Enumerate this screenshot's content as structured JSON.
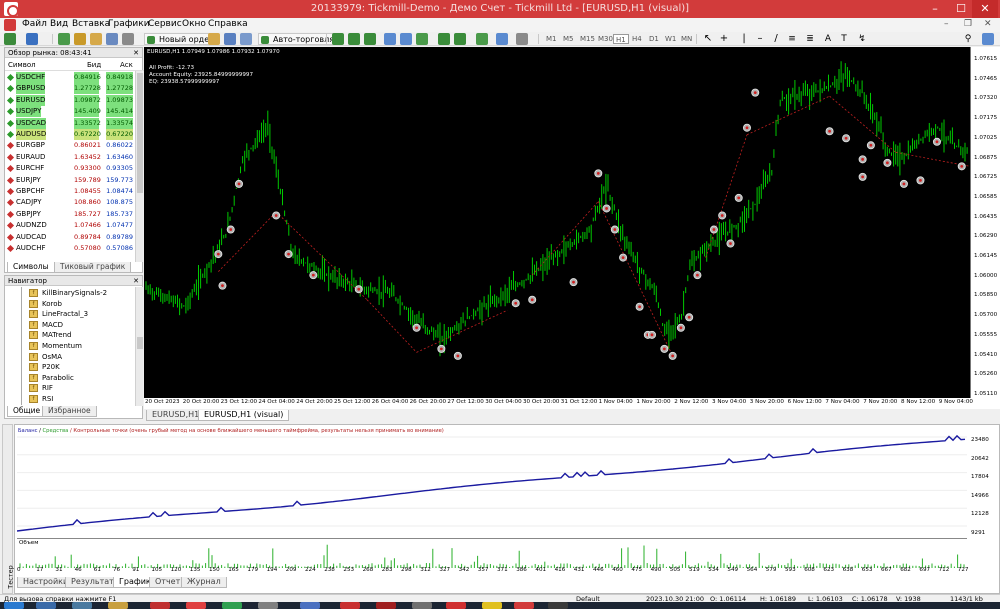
{
  "window": {
    "title": "20133979: Tickmill-Demo - Демо Счет - Tickmill Ltd - [EURUSD,H1 (visual)]"
  },
  "menu": [
    "Файл",
    "Вид",
    "Вставка",
    "Графики",
    "Сервис",
    "Окно",
    "Справка"
  ],
  "toolbar": {
    "new_order": "Новый ордер",
    "autotrade": "Авто-торговля",
    "timeframes": [
      "M1",
      "M5",
      "M15",
      "M30",
      "H1",
      "H4",
      "D1",
      "W1",
      "MN"
    ],
    "active_timeframe": "H1"
  },
  "market_watch": {
    "title": "Обзор рынка: 08:43:41",
    "col_symbol": "Символ",
    "col_bid": "Бид",
    "col_ask": "Аск",
    "rows": [
      {
        "symbol": "USDCHF",
        "bid": "0.84916",
        "ask": "0.84918",
        "bg": "#7de07d"
      },
      {
        "symbol": "GBPUSD",
        "bid": "1.27728",
        "ask": "1.27728",
        "bg": "#7de07d"
      },
      {
        "symbol": "EURUSD",
        "bid": "1.09872",
        "ask": "1.09873",
        "bg": "#7de07d"
      },
      {
        "symbol": "USDJPY",
        "bid": "145.409",
        "ask": "145.414",
        "bg": "#7de07d"
      },
      {
        "symbol": "USDCAD",
        "bid": "1.33572",
        "ask": "1.33574",
        "bg": "#7de07d"
      },
      {
        "symbol": "AUDUSD",
        "bid": "0.67220",
        "ask": "0.67220",
        "bg": "#c9e27a"
      },
      {
        "symbol": "EURGBP",
        "bid": "0.86021",
        "ask": "0.86022",
        "bg": "#ffffff"
      },
      {
        "symbol": "EURAUD",
        "bid": "1.63452",
        "ask": "1.63460",
        "bg": "#ffffff"
      },
      {
        "symbol": "EURCHF",
        "bid": "0.93300",
        "ask": "0.93305",
        "bg": "#ffffff"
      },
      {
        "symbol": "EURJPY",
        "bid": "159.789",
        "ask": "159.773",
        "bg": "#ffffff"
      },
      {
        "symbol": "GBPCHF",
        "bid": "1.08455",
        "ask": "1.08474",
        "bg": "#ffffff"
      },
      {
        "symbol": "CADJPY",
        "bid": "108.860",
        "ask": "108.875",
        "bg": "#ffffff"
      },
      {
        "symbol": "GBPJPY",
        "bid": "185.727",
        "ask": "185.737",
        "bg": "#ffffff"
      },
      {
        "symbol": "AUDNZD",
        "bid": "1.07466",
        "ask": "1.07477",
        "bg": "#ffffff"
      },
      {
        "symbol": "AUDCAD",
        "bid": "0.89784",
        "ask": "0.89789",
        "bg": "#ffffff"
      },
      {
        "symbol": "AUDCHF",
        "bid": "0.57080",
        "ask": "0.57086",
        "bg": "#ffffff"
      }
    ],
    "tab_symbols": "Символы",
    "tab_tick": "Тиковый график"
  },
  "navigator": {
    "title": "Навигатор",
    "items": [
      "KillBinarySignals-2",
      "Korob",
      "LineFractal_3",
      "MACD",
      "MATrend",
      "Momentum",
      "OsMA",
      "P20K",
      "Parabolic",
      "RIF",
      "RSI"
    ],
    "tab_common": "Общие",
    "tab_favorites": "Избранное"
  },
  "chart": {
    "header": "EURUSD,H1  1.07949 1.07986 1.07932 1.07970",
    "all_profit": "All Profit: -12.73",
    "equity": "Account Equity: 23925.84999999997",
    "eq": "EQ: 23938.57999999997",
    "y_labels": [
      "1.07615",
      "1.07465",
      "1.07320",
      "1.07175",
      "1.07025",
      "1.06875",
      "1.06725",
      "1.06585",
      "1.06435",
      "1.06290",
      "1.06145",
      "1.06000",
      "1.05850",
      "1.05700",
      "1.05555",
      "1.05410",
      "1.05260",
      "1.05110"
    ],
    "x_labels": [
      "20 Oct 2023",
      "20 Oct 20:00",
      "23 Oct 12:00",
      "24 Oct 04:00",
      "24 Oct 20:00",
      "25 Oct 12:00",
      "26 Oct 04:00",
      "26 Oct 20:00",
      "27 Oct 12:00",
      "30 Oct 04:00",
      "30 Oct 20:00",
      "31 Oct 12:00",
      "1 Nov 04:00",
      "1 Nov 20:00",
      "2 Nov 12:00",
      "3 Nov 04:00",
      "3 Nov 20:00",
      "6 Nov 12:00",
      "7 Nov 04:00",
      "7 Nov 20:00",
      "8 Nov 12:00",
      "9 Nov 04:00"
    ],
    "tabs": [
      "EURUSD,H1",
      "EURUSD,H1 (visual)"
    ]
  },
  "report": {
    "legend_balance": "Баланс",
    "legend_equity": "Средства",
    "legend_rest": "/ Контрольные точки (очень грубый метод на основе ближайшего меньшего таймфрейма, результаты нельзя принимать во внимание)",
    "y_labels": [
      "23480",
      "20642",
      "17804",
      "14966",
      "12128",
      "9291"
    ],
    "volume_label": "Объем",
    "x_labels": [
      "0",
      "17",
      "31",
      "46",
      "61",
      "76",
      "91",
      "105",
      "120",
      "135",
      "150",
      "165",
      "179",
      "194",
      "209",
      "224",
      "238",
      "253",
      "268",
      "283",
      "298",
      "312",
      "327",
      "342",
      "357",
      "371",
      "386",
      "401",
      "416",
      "431",
      "446",
      "460",
      "475",
      "490",
      "505",
      "519",
      "534",
      "549",
      "564",
      "579",
      "593",
      "608",
      "623",
      "638",
      "653",
      "667",
      "682",
      "697",
      "712",
      "727"
    ],
    "tabs": [
      "Настройки",
      "Результаты",
      "График",
      "Отчет",
      "Журнал"
    ],
    "active_tab": "График",
    "side_label": "Тестер"
  },
  "status": {
    "help": "Для вызова справки нажмите F1",
    "profile": "Default",
    "datetime": "2023.10.30 21:00",
    "open": "O: 1.06114",
    "high": "H: 1.06189",
    "low": "L: 1.06103",
    "close": "C: 1.06178",
    "volume": "V: 1938",
    "traffic": "1143/1 kb"
  },
  "colors": {
    "balance": "#1a1aa0",
    "candles": "#00c800",
    "accent": "#d23b3b"
  }
}
